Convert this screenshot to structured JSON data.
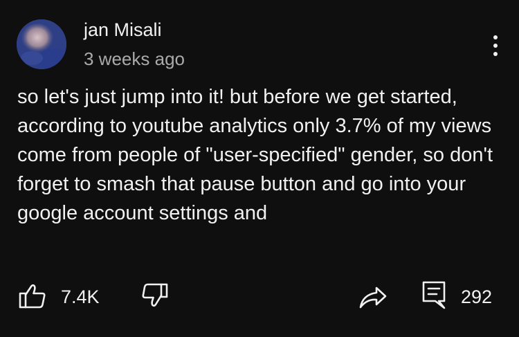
{
  "post": {
    "author": {
      "name": "jan Misali",
      "avatar_icon": "avatar-icon"
    },
    "time": "3 weeks ago",
    "menu_icon": "more-vertical-icon",
    "text": "so let's just jump into it! but before we get started, according to youtube analytics only 3.7% of my views come from people of \"user-specified\" gender, so don't forget to smash that pause button and go into your google account settings and",
    "actions": {
      "like_icon": "thumbs-up-icon",
      "like_count": "7.4K",
      "dislike_icon": "thumbs-down-icon",
      "share_icon": "share-icon",
      "comment_icon": "comment-icon",
      "comment_count": "292"
    }
  },
  "colors": {
    "background": "#0f0f0f",
    "primary_text": "#f1f1f1",
    "secondary_text": "#aaaaaa"
  }
}
